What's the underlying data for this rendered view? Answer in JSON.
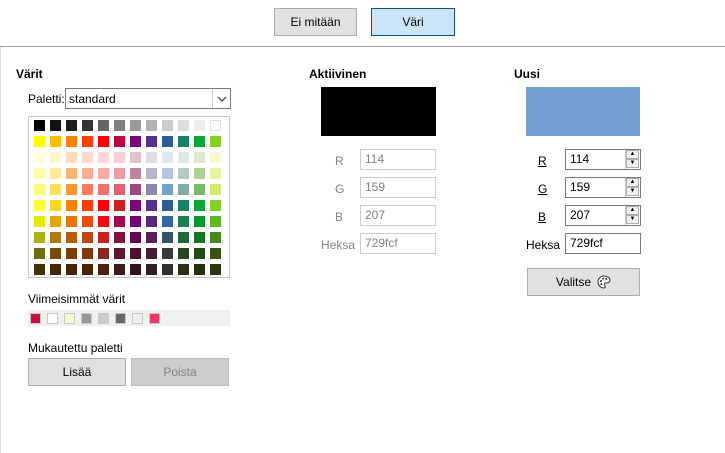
{
  "tabs": {
    "none_label": "Ei mitään",
    "none_accel": "E",
    "color_label": "Väri",
    "color_accel": "V"
  },
  "colors_section": {
    "title": "Värit",
    "palette_label": "Paletti:",
    "palette_value": "standard",
    "recent_title": "Viimeisimmät värit",
    "custom_palette_title": "Mukautettu paletti",
    "add_label": "Lisää",
    "delete_label": "Poista"
  },
  "active": {
    "title": "Aktiivinen",
    "swatch_color": "#000000",
    "r_label": "R",
    "r_value": "114",
    "g_label": "G",
    "g_value": "159",
    "b_label": "B",
    "b_value": "207",
    "hex_label": "Heksa",
    "hex_value": "729fcf"
  },
  "new": {
    "title": "Uusi",
    "swatch_color": "#729fcf",
    "r_label": "R",
    "r_value": "114",
    "g_label": "G",
    "g_value": "159",
    "b_label": "B",
    "b_value": "207",
    "hex_label": "Heksa",
    "hex_value": "729fcf",
    "pick_label": "Valitse"
  },
  "palette_rows": [
    [
      "#000000",
      "#111111",
      "#1c1c1c",
      "#333333",
      "#666666",
      "#808080",
      "#999999",
      "#b2b2b2",
      "#cccccc",
      "#dddddd",
      "#eeeeee",
      "#ffffff"
    ],
    [
      "#ffff00",
      "#ffbf00",
      "#ff8000",
      "#ff4000",
      "#ff0000",
      "#bf0041",
      "#800080",
      "#55308d",
      "#2a6099",
      "#158466",
      "#00a933",
      "#81d41a"
    ],
    [
      "#ffffd7",
      "#fff5ce",
      "#ffdbb6",
      "#ffd8ce",
      "#ffd7d7",
      "#f7d1d5",
      "#e0c2cd",
      "#dedce6",
      "#dee6ef",
      "#dee7e5",
      "#dde8cb",
      "#f6f9d4"
    ],
    [
      "#ffffa6",
      "#ffe994",
      "#ffb66c",
      "#ffaa95",
      "#ffa6a6",
      "#ec9ba4",
      "#bf819e",
      "#b7b3ca",
      "#b4c7dc",
      "#b3cac7",
      "#afd095",
      "#e8f2a1"
    ],
    [
      "#ffff6d",
      "#ffde59",
      "#ff972f",
      "#ff7b59",
      "#ff6d6d",
      "#e16173",
      "#a1467e",
      "#8e86ae",
      "#729fcf",
      "#81aca6",
      "#77bc65",
      "#d4ea6b"
    ],
    [
      "#ffff38",
      "#ffd428",
      "#ff8000",
      "#ff4000",
      "#ff0000",
      "#c9211e",
      "#800080",
      "#55308d",
      "#2a6099",
      "#158466",
      "#00a933",
      "#81d41a"
    ],
    [
      "#e6e905",
      "#e8a202",
      "#ea7500",
      "#ed4c05",
      "#f10d0c",
      "#a7074b",
      "#780373",
      "#5b277d",
      "#3465a4",
      "#168253",
      "#069a2e",
      "#5eb91e"
    ],
    [
      "#acb20c",
      "#b47804",
      "#b85c00",
      "#be480a",
      "#c9211e",
      "#861141",
      "#650953",
      "#55215b",
      "#355269",
      "#1e6a39",
      "#127622",
      "#468a1a"
    ],
    [
      "#706e0c",
      "#784b04",
      "#7b3d00",
      "#813709",
      "#8d281e",
      "#611729",
      "#4e102d",
      "#481d32",
      "#383d3c",
      "#28471f",
      "#224b12",
      "#395511"
    ],
    [
      "#443205",
      "#472702",
      "#492300",
      "#4b2204",
      "#50200c",
      "#41191d",
      "#361120",
      "#301e2a",
      "#2e2f33",
      "#2b3014",
      "#24310f",
      "#2c360e"
    ]
  ],
  "recent_colors": [
    "#c9113f",
    "#ffffff",
    "#f6f9d4",
    "#999999",
    "#cccccc",
    "#666666",
    "#f0f0f0",
    "#ff3366"
  ]
}
